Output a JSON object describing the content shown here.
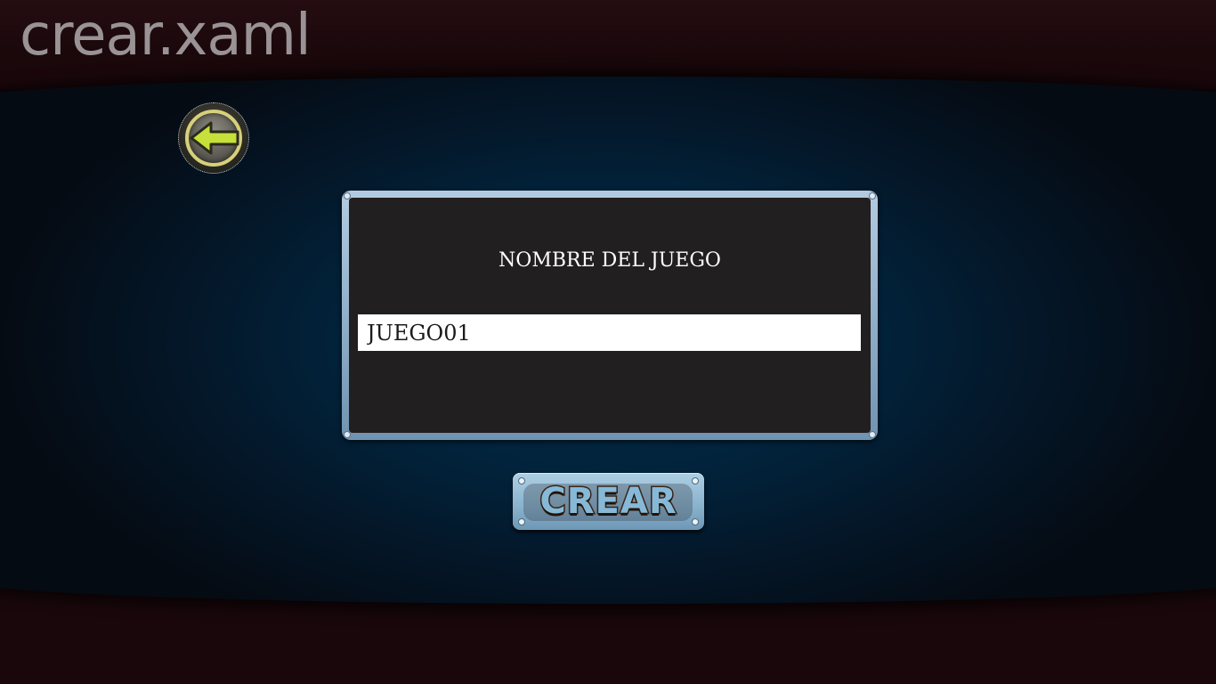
{
  "page": {
    "title": "crear.xaml"
  },
  "nav": {
    "back_icon": "arrow-left-icon"
  },
  "form": {
    "label": "NOMBRE DEL JUEGO",
    "name_value": "JUEGO01",
    "name_placeholder": ""
  },
  "actions": {
    "create_label": "CREAR"
  },
  "colors": {
    "background": "#19070b",
    "arena": "#02223a",
    "panel": "#221f20",
    "frame": "#8fb3cf",
    "accent_arrow": "#c7e03a"
  }
}
